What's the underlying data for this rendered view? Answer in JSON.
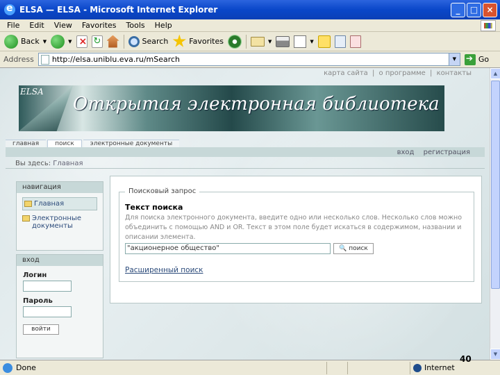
{
  "window": {
    "title": "ELSA — ELSA - Microsoft Internet Explorer"
  },
  "menu": [
    "File",
    "Edit",
    "View",
    "Favorites",
    "Tools",
    "Help"
  ],
  "toolbar": {
    "back_label": "Back",
    "search_label": "Search",
    "favorites_label": "Favorites"
  },
  "address": {
    "label": "Address",
    "url": "http://elsa.uniblu.eva.ru/mSearch",
    "go_label": "Go"
  },
  "site": {
    "top_links": [
      "карта сайта",
      "|",
      "о программе",
      "|",
      "контакты"
    ],
    "logo_small": "ELSA",
    "logo_title": "Открытая электронная библиотека",
    "tabs": [
      "главная",
      "поиск",
      "электронные документы"
    ],
    "auth_links": [
      "вход",
      "регистрация"
    ],
    "breadcrumb_prefix": "Вы здесь:",
    "breadcrumb_current": "Главная"
  },
  "nav_panel": {
    "title": "навигация",
    "items": [
      "Главная",
      "Электронные документы"
    ]
  },
  "login_panel": {
    "title": "вход",
    "login_label": "Логин",
    "password_label": "Пароль",
    "login_button": "войти"
  },
  "search_form": {
    "legend": "Поисковый запрос",
    "title": "Текст поиска",
    "description": "Для поиска электронного документа, введите одно или несколько слов. Несколько слов можно объединить с помощью AND и OR. Текст в этом поле будет искаться в содержимом, названии и описании элемента.",
    "query_value": "\"акционерное общество\"",
    "search_button": "поиск",
    "advanced_link": "Расширенный поиск"
  },
  "status": {
    "text": "Done",
    "zone": "Internet",
    "slide_number": "40"
  }
}
